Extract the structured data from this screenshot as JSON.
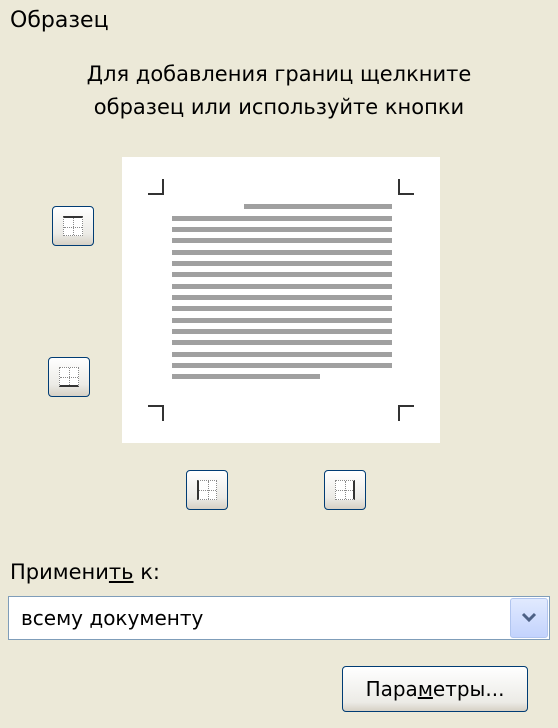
{
  "section_title": "Образец",
  "instructions": {
    "line1": "Для добавления границ щелкните",
    "line2": "образец или используйте кнопки"
  },
  "apply_to": {
    "label_pre": "Примени",
    "label_mnemonic": "ть",
    "label_post": " к:",
    "selected": "всему документу"
  },
  "options_button": {
    "pre": "Пара",
    "mnemonic": "м",
    "post": "етры..."
  },
  "border_buttons": [
    "top-border",
    "bottom-border",
    "left-border",
    "right-border"
  ],
  "icons": {
    "dropdown": "chevron-down-icon"
  },
  "colors": {
    "dialog_bg": "#ece9d8",
    "preview_lines": "#a0a0a0",
    "dropdown_chevron": "#4d6185"
  }
}
